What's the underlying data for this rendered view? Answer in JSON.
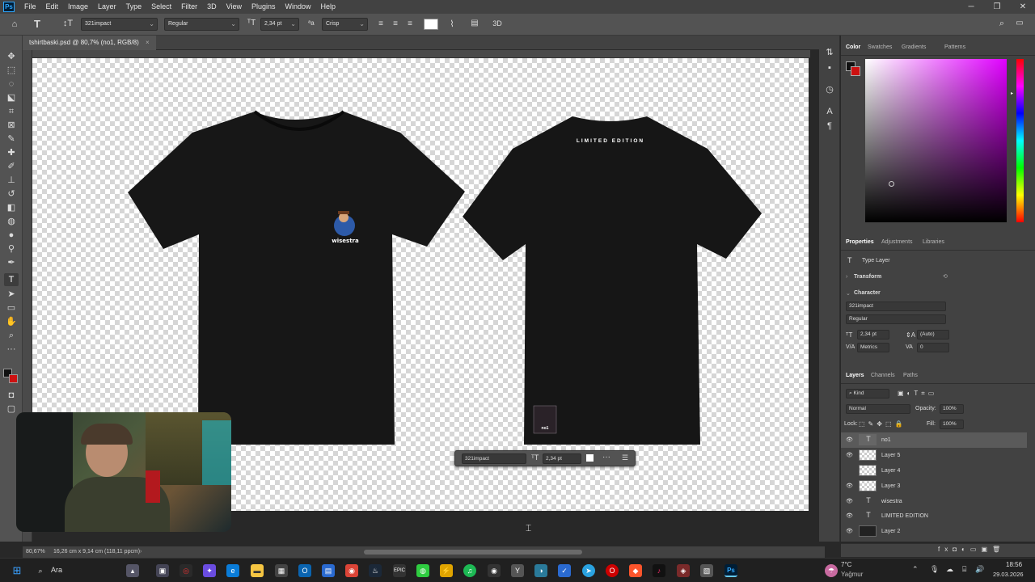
{
  "menubar": {
    "logo": "Ps",
    "items": [
      "File",
      "Edit",
      "Image",
      "Layer",
      "Type",
      "Select",
      "Filter",
      "3D",
      "View",
      "Plugins",
      "Window",
      "Help"
    ]
  },
  "options": {
    "font_family": "321impact",
    "font_style": "Regular",
    "font_size": "2,34 pt",
    "antialias": "Crisp",
    "three_d": "3D"
  },
  "document": {
    "tab_title": "tshirtbaski.psd @ 80,7% (no1, RGB/8)",
    "close": "×"
  },
  "artwork": {
    "front_logo_text": "wisestra",
    "back_text": "LIMITED EDITION",
    "small_logo_text": "no1"
  },
  "floatbar": {
    "font": "321impact",
    "size": "2,34 pt"
  },
  "status": {
    "zoom": "80,67%",
    "doc_info": "16,26 cm x 9,14 cm (118,11 ppcm)"
  },
  "color_panel": {
    "tabs": [
      "Color",
      "Swatches",
      "Gradients",
      "Patterns"
    ],
    "hue": "#e000ff",
    "fg": "#111111",
    "bg": "#cc1111"
  },
  "properties_panel": {
    "tabs": [
      "Properties",
      "Adjustments",
      "Libraries"
    ],
    "layer_type": "Type Layer",
    "transform_label": "Transform",
    "character_label": "Character",
    "font": "321impact",
    "style": "Regular",
    "size": "2,34 pt",
    "leading": "(Auto)",
    "kerning": "Metrics",
    "tracking": "0"
  },
  "layers_panel": {
    "tabs": [
      "Layers",
      "Channels",
      "Paths"
    ],
    "kind": "Kind",
    "blend": "Normal",
    "opacity_label": "Opacity:",
    "opacity": "100%",
    "lock_label": "Lock:",
    "fill_label": "Fill:",
    "fill": "100%",
    "layers": [
      {
        "name": "no1",
        "type": "text",
        "visible": true,
        "selected": true
      },
      {
        "name": "Layer 5",
        "type": "pixel",
        "visible": true,
        "selected": false
      },
      {
        "name": "Layer 4",
        "type": "pixel",
        "visible": false,
        "selected": false
      },
      {
        "name": "Layer 3",
        "type": "pixel",
        "visible": true,
        "selected": false
      },
      {
        "name": "wisestra",
        "type": "text",
        "visible": true,
        "selected": false
      },
      {
        "name": "LIMITED EDITION",
        "type": "text",
        "visible": true,
        "selected": false
      },
      {
        "name": "Layer 2",
        "type": "pixel",
        "visible": true,
        "selected": false
      }
    ]
  },
  "taskbar": {
    "search": "Ara",
    "weather_temp": "7°C",
    "weather_desc": "Yağmur",
    "time": "18:56",
    "date": "29.03.2026"
  }
}
